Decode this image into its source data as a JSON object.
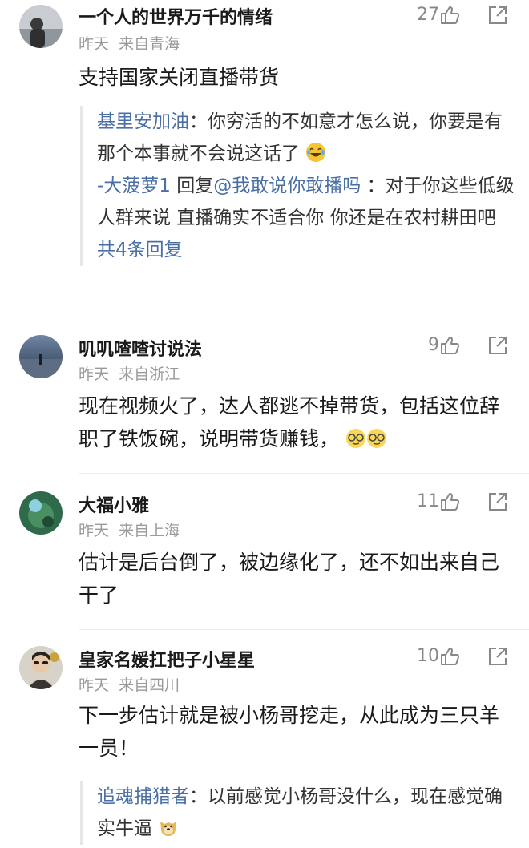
{
  "comments": [
    {
      "name": "一个人的世界万千的情绪",
      "date": "昨天",
      "location": "来自青海",
      "likes": "27",
      "text": "支持国家关闭直播带货",
      "replies": [
        {
          "name": "基里安加油",
          "text": "：你穷活的不如意才怎么说，你要是有那个本事就不会说这话了"
        },
        {
          "name": "-大菠萝1",
          "verb": "回复",
          "target": "@我敢说你敢播吗",
          "text": "：对于你这些低级人群来说 直播确实不适合你 你还是在农村耕田吧"
        }
      ],
      "more_replies": "共4条回复"
    },
    {
      "name": "叽叽喳喳讨说法",
      "date": "昨天",
      "location": "来自浙江",
      "likes": "9",
      "text": "现在视频火了，达人都逃不掉带货，包括这位辞职了铁饭碗，说明带货赚钱，"
    },
    {
      "name": "大福小雅",
      "date": "昨天",
      "location": "来自上海",
      "likes": "11",
      "text": "估计是后台倒了，被边缘化了，还不如出来自己干了"
    },
    {
      "name": "皇家名媛扛把子小星星",
      "date": "昨天",
      "location": "来自四川",
      "likes": "10",
      "text": "下一步估计就是被小杨哥挖走，从此成为三只羊一员！",
      "replies": [
        {
          "name": "追魂捕猎者",
          "text": "：以前感觉小杨哥没什么，现在感觉确实牛逼"
        }
      ]
    }
  ],
  "icons": {
    "like": "thumbs-up-icon",
    "share": "share-icon",
    "emoji_laugh": "laughing-tears-emoji",
    "emoji_glasses": "glasses-face-emoji",
    "emoji_doge": "doge-emoji"
  },
  "colors": {
    "link": "#4a6fa5",
    "meta": "#9a9a9a",
    "divider": "#ececec"
  }
}
